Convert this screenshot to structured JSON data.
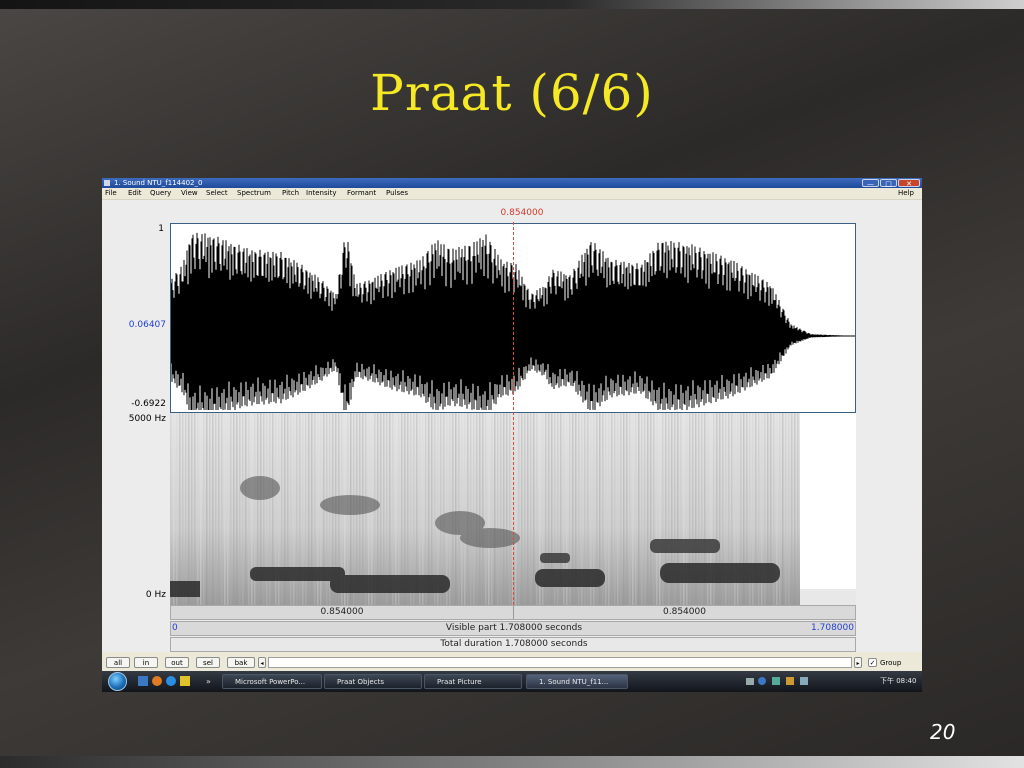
{
  "slide": {
    "title": "Praat (6/6)",
    "page_number": "20"
  },
  "window": {
    "title": "1. Sound NTU_f114402_0",
    "menus": [
      "File",
      "Edit",
      "Query",
      "View",
      "Select",
      "Spectrum",
      "Pitch",
      "Intensity",
      "Formant",
      "Pulses"
    ],
    "help": "Help",
    "controls": {
      "minimize": "—",
      "maximize": "□",
      "close": "✕"
    }
  },
  "editor": {
    "cursor_time": "0.854000",
    "wave_top": "1",
    "wave_mid": "0.06407",
    "wave_bottom": "-0.6922",
    "spec_top": "5000 Hz",
    "spec_bottom": "0 Hz",
    "sel_left": "0.854000",
    "sel_right": "0.854000",
    "visible_start": "0",
    "visible_part": "Visible part 1.708000 seconds",
    "visible_end": "1.708000",
    "total_duration": "Total duration 1.708000 seconds",
    "colors": {
      "cursor": "#d84a3a",
      "axis_blue": "#1f3fd6",
      "frame": "#3c5f84"
    }
  },
  "bottom_buttons": [
    "all",
    "in",
    "out",
    "sel",
    "bak"
  ],
  "group_label": "Group",
  "group_checked": true,
  "taskbar": {
    "items": [
      "Microsoft PowerPo...",
      "Praat Objects",
      "Praat Picture",
      "1. Sound NTU_f11..."
    ],
    "active_index": 3,
    "more": "»",
    "clock": "下午 08:40"
  }
}
